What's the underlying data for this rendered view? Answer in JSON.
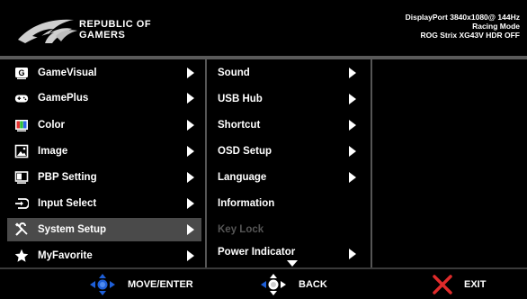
{
  "header": {
    "logo_line1": "REPUBLIC OF",
    "logo_line2": "GAMERS",
    "info_line1": "DisplayPort 3840x1080@ 144Hz",
    "info_line2": "Racing Mode",
    "info_line3": "ROG Strix XG43V HDR OFF"
  },
  "menu": {
    "items": [
      {
        "label": "GameVisual",
        "icon": "gamevisual-icon",
        "selected": false
      },
      {
        "label": "GamePlus",
        "icon": "gamepad-icon",
        "selected": false
      },
      {
        "label": "Color",
        "icon": "color-icon",
        "selected": false
      },
      {
        "label": "Image",
        "icon": "image-icon",
        "selected": false
      },
      {
        "label": "PBP Setting",
        "icon": "pbp-icon",
        "selected": false
      },
      {
        "label": "Input Select",
        "icon": "input-select-icon",
        "selected": false
      },
      {
        "label": "System Setup",
        "icon": "wrench-screwdriver-icon",
        "selected": true
      },
      {
        "label": "MyFavorite",
        "icon": "star-icon",
        "selected": false
      }
    ]
  },
  "submenu": {
    "items": [
      {
        "label": "Sound",
        "has_arrow": true,
        "disabled": false
      },
      {
        "label": "USB Hub",
        "has_arrow": true,
        "disabled": false
      },
      {
        "label": "Shortcut",
        "has_arrow": true,
        "disabled": false
      },
      {
        "label": "OSD Setup",
        "has_arrow": true,
        "disabled": false
      },
      {
        "label": "Language",
        "has_arrow": true,
        "disabled": false
      },
      {
        "label": "Information",
        "has_arrow": false,
        "disabled": false
      },
      {
        "label": "Key Lock",
        "has_arrow": false,
        "disabled": true
      },
      {
        "label": "Power Indicator",
        "has_arrow": true,
        "disabled": false
      }
    ]
  },
  "footer": {
    "move_label": "MOVE/ENTER",
    "back_label": "BACK",
    "exit_label": "EXIT"
  },
  "colors": {
    "selected_bg": "#4a4a4a",
    "joystick_blue": "#1e5fd8",
    "exit_red": "#e02b2b",
    "disabled_text": "#555555"
  }
}
